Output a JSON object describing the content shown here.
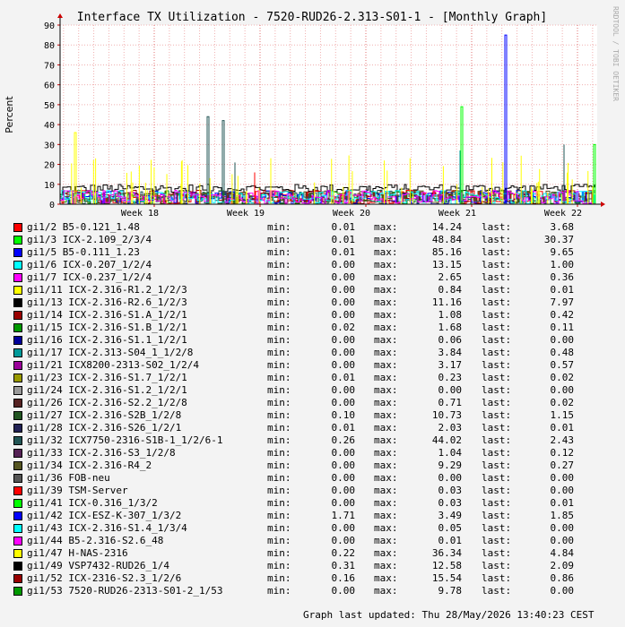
{
  "chart_data": {
    "type": "line",
    "title": "Interface TX Utilization - 7520-RUD26-2.313-S01-1 - [Monthly Graph]",
    "ylabel": "Percent",
    "xlabel": "",
    "watermark": "RRDTOOL / TOBI OETIKER",
    "ylim": [
      0,
      90
    ],
    "yticks": [
      "0",
      "10",
      "20",
      "30",
      "40",
      "50",
      "60",
      "70",
      "80",
      "90"
    ],
    "xticks": [
      "Week 18",
      "Week 19",
      "Week 20",
      "Week 21",
      "Week 22"
    ],
    "grid": true,
    "notable_spikes": [
      {
        "series": "gi1/32 ICX7750-2316-S1B-1_1/2/6-1",
        "x": "Week 18",
        "value": 44
      },
      {
        "series": "gi1/32 ICX7750-2316-S1B-1_1/2/6-1",
        "x": "Week 18",
        "value": 42
      },
      {
        "series": "gi1/3 ICX-2.109_2/3/4",
        "x": "Week 21",
        "value": 49
      },
      {
        "series": "gi1/5 B5-0.111_1.23",
        "x": "Week 21",
        "value": 85
      },
      {
        "series": "gi1/47 H-NAS-2316",
        "x": "Week 17",
        "value": 36
      },
      {
        "series": "gi1/3 ICX-2.109_2/3/4",
        "x": "Week 22",
        "value": 30
      }
    ]
  },
  "legend": [
    {
      "color": "#ff0000",
      "label": "gi1/2 B5-0.121_1.48",
      "min": "0.01",
      "max": "14.24",
      "last": "3.68"
    },
    {
      "color": "#00ff00",
      "label": "gi1/3 ICX-2.109_2/3/4",
      "min": "0.01",
      "max": "48.84",
      "last": "30.37"
    },
    {
      "color": "#0000ff",
      "label": "gi1/5 B5-0.111_1.23",
      "min": "0.01",
      "max": "85.16",
      "last": "9.65"
    },
    {
      "color": "#00ffff",
      "label": "gi1/6 ICX-0.207_1/2/4",
      "min": "0.00",
      "max": "13.15",
      "last": "1.00"
    },
    {
      "color": "#ff00ff",
      "label": "gi1/7 ICX-0.237_1/2/4",
      "min": "0.00",
      "max": "2.65",
      "last": "0.36"
    },
    {
      "color": "#ffff00",
      "label": "gi1/11 ICX-2.316-R1.2_1/2/3",
      "min": "0.00",
      "max": "0.84",
      "last": "0.01"
    },
    {
      "color": "#000000",
      "label": "gi1/13 ICX-2.316-R2.6_1/2/3",
      "min": "0.00",
      "max": "11.16",
      "last": "7.97"
    },
    {
      "color": "#990000",
      "label": "gi1/14 ICX-2.316-S1.A_1/2/1",
      "min": "0.00",
      "max": "1.08",
      "last": "0.42"
    },
    {
      "color": "#009900",
      "label": "gi1/15 ICX-2.316-S1.B_1/2/1",
      "min": "0.02",
      "max": "1.68",
      "last": "0.11"
    },
    {
      "color": "#000099",
      "label": "gi1/16 ICX-2.316-S1.1_1/2/1",
      "min": "0.00",
      "max": "0.06",
      "last": "0.00"
    },
    {
      "color": "#009999",
      "label": "gi1/17 ICX-2.313-S04_1_1/2/8",
      "min": "0.00",
      "max": "3.84",
      "last": "0.48"
    },
    {
      "color": "#990099",
      "label": "gi1/21 ICX8200-2313-S02_1/2/4",
      "min": "0.00",
      "max": "3.17",
      "last": "0.57"
    },
    {
      "color": "#999900",
      "label": "gi1/23 ICX-2.316-S1.7_1/2/1",
      "min": "0.01",
      "max": "0.23",
      "last": "0.02"
    },
    {
      "color": "#999999",
      "label": "gi1/24 ICX-2.316-S1.2_1/2/1",
      "min": "0.00",
      "max": "0.00",
      "last": "0.00"
    },
    {
      "color": "#552222",
      "label": "gi1/26 ICX-2.316-S2.2_1/2/8",
      "min": "0.00",
      "max": "0.71",
      "last": "0.02"
    },
    {
      "color": "#225522",
      "label": "gi1/27 ICX-2.316-S2B_1/2/8",
      "min": "0.10",
      "max": "10.73",
      "last": "1.15"
    },
    {
      "color": "#222255",
      "label": "gi1/28 ICX-2.316-S26_1/2/1",
      "min": "0.01",
      "max": "2.03",
      "last": "0.01"
    },
    {
      "color": "#225555",
      "label": "gi1/32 ICX7750-2316-S1B-1_1/2/6-1",
      "min": "0.26",
      "max": "44.02",
      "last": "2.43"
    },
    {
      "color": "#552255",
      "label": "gi1/33 ICX-2.316-S3_1/2/8",
      "min": "0.00",
      "max": "1.04",
      "last": "0.12"
    },
    {
      "color": "#555522",
      "label": "gi1/34 ICX-2.316-R4_2",
      "min": "0.00",
      "max": "9.29",
      "last": "0.27"
    },
    {
      "color": "#555555",
      "label": "gi1/36 FOB-neu",
      "min": "0.00",
      "max": "0.00",
      "last": "0.00"
    },
    {
      "color": "#ff0000",
      "label": "gi1/39 TSM-Server",
      "min": "0.00",
      "max": "0.03",
      "last": "0.00"
    },
    {
      "color": "#00ff00",
      "label": "gi1/41 ICX-0.316_1/3/2",
      "min": "0.00",
      "max": "0.03",
      "last": "0.01"
    },
    {
      "color": "#0000ff",
      "label": "gi1/42 ICX-ESZ-K-307_1/3/2",
      "min": "1.71",
      "max": "3.49",
      "last": "1.85"
    },
    {
      "color": "#00ffff",
      "label": "gi1/43 ICX-2.316-S1.4_1/3/4",
      "min": "0.00",
      "max": "0.05",
      "last": "0.00"
    },
    {
      "color": "#ff00ff",
      "label": "gi1/44 B5-2.316-S2.6_48",
      "min": "0.00",
      "max": "0.01",
      "last": "0.00"
    },
    {
      "color": "#ffff00",
      "label": "gi1/47 H-NAS-2316",
      "min": "0.22",
      "max": "36.34",
      "last": "4.84"
    },
    {
      "color": "#000000",
      "label": "gi1/49 VSP7432-RUD26_1/4",
      "min": "0.31",
      "max": "12.58",
      "last": "2.09"
    },
    {
      "color": "#990000",
      "label": "gi1/52 ICX-2316-S2.3_1/2/6",
      "min": "0.16",
      "max": "15.54",
      "last": "0.86"
    },
    {
      "color": "#009900",
      "label": "gi1/53 7520-RUD26-2313-S01-2_1/53",
      "min": "0.00",
      "max": "9.78",
      "last": "0.00"
    }
  ],
  "legend_labels": {
    "min": "min:",
    "max": "max:",
    "last": "last:"
  },
  "footer": "Graph last updated: Thu 28/May/2026 13:40:23 CEST"
}
